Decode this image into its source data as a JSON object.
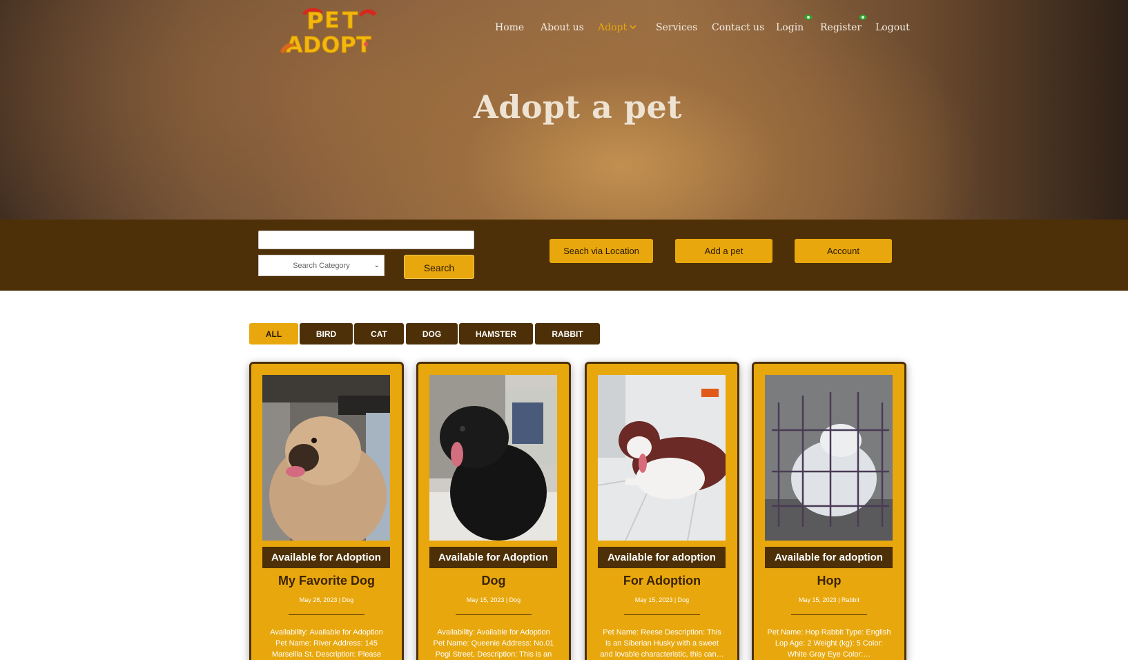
{
  "brand": {
    "logo_text_line1": "PET",
    "logo_text_line2": "ADOPT"
  },
  "nav": {
    "items": [
      {
        "label": "Home"
      },
      {
        "label": "About us"
      },
      {
        "label": "Adopt"
      },
      {
        "label": "Services"
      },
      {
        "label": "Contact us"
      },
      {
        "label": "Login"
      },
      {
        "label": "Register"
      },
      {
        "label": "Logout"
      }
    ],
    "active": "Adopt",
    "active_color": "#e8a70c"
  },
  "hero": {
    "title": "Adopt a pet"
  },
  "search": {
    "input_value": "",
    "category_placeholder": "Search Category",
    "search_label": "Search",
    "location_label": "Seach via Location",
    "add_label": "Add a pet",
    "account_label": "Account"
  },
  "filters": {
    "items": [
      "ALL",
      "BIRD",
      "CAT",
      "DOG",
      "HAMSTER",
      "RABBIT"
    ],
    "active": "ALL"
  },
  "cards": [
    {
      "badge": "Available for Adoption",
      "title": "My Favorite Dog",
      "meta": "May 28, 2023 | Dog",
      "description": "Availability: Available for Adoption Pet Name: River Address: 145 Marseilla St. Description: Please"
    },
    {
      "badge": "Available for Adoption",
      "title": "Dog",
      "meta": "May 15, 2023 | Dog",
      "description": "Availability: Available for Adoption Pet Name: Queenie Address: No.01 Pogi Street, Description: This is an"
    },
    {
      "badge": "Available for adoption",
      "title": "For Adoption",
      "meta": "May 15, 2023 | Dog",
      "description": "Pet Name: Reese Description: This is an Siberian Husky with a sweet and lovable characteristic, this can…"
    },
    {
      "badge": "Available for adoption",
      "title": "Hop",
      "meta": "May 15, 2023 | Rabbit",
      "description": "Pet Name: Hop Rabbit Type: English Lop Age: 2 Weight (kg): 5 Color: White Gray Eye Color:…"
    }
  ],
  "colors": {
    "brown": "#4d3007",
    "gold": "#e8a70c",
    "eye_green": "#2fa62f"
  }
}
